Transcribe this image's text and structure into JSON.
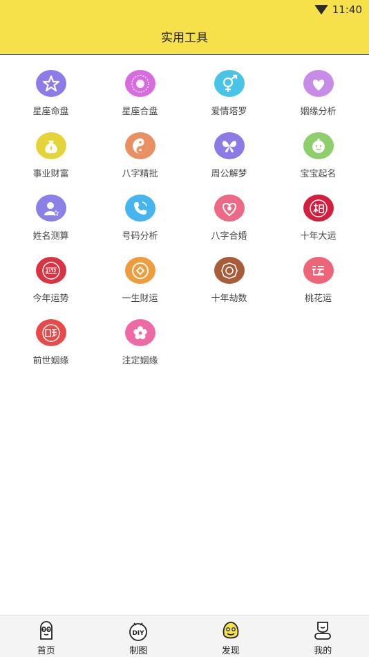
{
  "status": {
    "time": "11:40"
  },
  "header": {
    "title": "实用工具"
  },
  "tools": [
    {
      "label": "星座命盘",
      "icon": "star-icon",
      "color": "#8f7be8"
    },
    {
      "label": "星座合盘",
      "icon": "zodiac-icon",
      "color": "#d86be0"
    },
    {
      "label": "爱情塔罗",
      "icon": "gender-icon",
      "color": "#4ac4e6"
    },
    {
      "label": "姻缘分析",
      "icon": "hearts-icon",
      "color": "#c78ce8"
    },
    {
      "label": "事业财富",
      "icon": "money-bag-icon",
      "color": "#e4d43a"
    },
    {
      "label": "八字精批",
      "icon": "yin-yang-icon",
      "color": "#e89062"
    },
    {
      "label": "周公解梦",
      "icon": "butterfly-icon",
      "color": "#8e7ae4"
    },
    {
      "label": "宝宝起名",
      "icon": "baby-icon",
      "color": "#8ccf6b"
    },
    {
      "label": "姓名测算",
      "icon": "person-icon",
      "color": "#8a80e8"
    },
    {
      "label": "号码分析",
      "icon": "phone-icon",
      "color": "#46b4ee"
    },
    {
      "label": "八字合婚",
      "icon": "heart-badge-icon",
      "color": "#ec6a86"
    },
    {
      "label": "十年大运",
      "icon": "dayun-seal-icon",
      "color": "#d41e3e"
    },
    {
      "label": "今年运势",
      "icon": "year-2019-icon",
      "color": "#d83444"
    },
    {
      "label": "一生财运",
      "icon": "coin-icon",
      "color": "#ee9c3c"
    },
    {
      "label": "十年劫数",
      "icon": "bagua-icon",
      "color": "#a85c3a"
    },
    {
      "label": "桃花运",
      "icon": "yun-icon",
      "color": "#ee6478"
    },
    {
      "label": "前世姻缘",
      "icon": "yinyuan-seal-icon",
      "color": "#e84a4a"
    },
    {
      "label": "注定姻缘",
      "icon": "blossom-icon",
      "color": "#ee6aa4"
    }
  ],
  "nav": [
    {
      "label": "首页",
      "icon": "home-face-icon"
    },
    {
      "label": "制图",
      "icon": "diy-icon"
    },
    {
      "label": "发现",
      "icon": "discover-face-icon"
    },
    {
      "label": "我的",
      "icon": "profile-icon"
    }
  ]
}
